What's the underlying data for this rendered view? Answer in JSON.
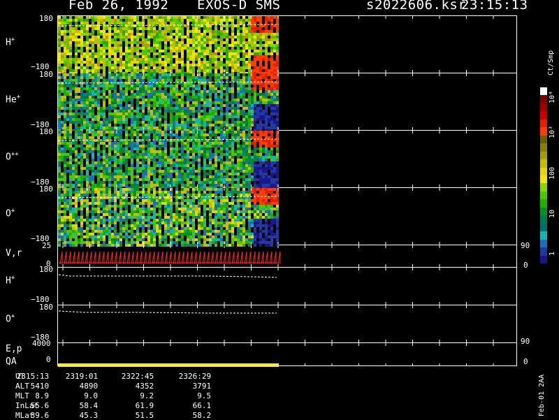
{
  "header": {
    "date": "Feb 26, 1992",
    "instrument": "EXOS-D SMS",
    "file": "s2022606.ksr",
    "time": "23:15:13"
  },
  "panels": [
    {
      "id": "h_plus",
      "label": "H",
      "sup": "+",
      "ymax": "180",
      "ymin": "−180"
    },
    {
      "id": "he_plus",
      "label": "He",
      "sup": "+",
      "ymax": "180",
      "ymin": "−180"
    },
    {
      "id": "o_pp",
      "label": "O",
      "sup": "++",
      "ymax": "180",
      "ymin": "−180"
    },
    {
      "id": "o_plus",
      "label": "O",
      "sup": "+",
      "ymax": "180",
      "ymin": "−180"
    }
  ],
  "vr_panel": {
    "label": "V,r",
    "ytop": "25",
    "ybot": "0",
    "rtop": "90",
    "rbot": "0"
  },
  "h_plus2": {
    "label": "H",
    "sup": "+",
    "ymax": "180",
    "ymin": "−180"
  },
  "o_plus2": {
    "label": "O",
    "sup": "+",
    "ymax": "180",
    "ymin": "−180"
  },
  "ep_panel": {
    "label": "E,p",
    "ytop": "4000",
    "ybot": "0",
    "rtop": "90",
    "rbot": "0"
  },
  "qa": {
    "label": "QA"
  },
  "colorbar": {
    "unit": "Ct/Smp",
    "ticks": [
      "10⁴",
      "10³",
      "100",
      "10",
      "1"
    ],
    "colors": [
      "#ffffff",
      "#7a0000",
      "#a00000",
      "#c80000",
      "#e61e00",
      "#ff3c00",
      "#6b5e00",
      "#8a7f00",
      "#a89c00",
      "#c8bc00",
      "#e6d600",
      "#f0e800",
      "#8ad400",
      "#4ec800",
      "#21b000",
      "#0a8c28",
      "#007850",
      "#006e6e",
      "#13b4b4",
      "#1e6ebe",
      "#1e3ca0",
      "#1e148c"
    ]
  },
  "ephemeris": {
    "rows": [
      {
        "name": "UT",
        "values": [
          "2315:13",
          "2319:01",
          "2322:45",
          "2326:29"
        ]
      },
      {
        "name": "ALT",
        "values": [
          "5410",
          "4890",
          "4352",
          "3791"
        ]
      },
      {
        "name": "MLT",
        "values": [
          "8.9",
          "9.0",
          "9.2",
          "9.5"
        ]
      },
      {
        "name": "InLat",
        "values": [
          "55.6",
          "58.4",
          "61.9",
          "66.1"
        ]
      },
      {
        "name": "MLat",
        "values": [
          "39.6",
          "45.3",
          "51.5",
          "58.2"
        ]
      }
    ]
  },
  "footer_side": "Feb-01 2AA",
  "chart_data": {
    "type": "heatmap",
    "title": "Feb 26, 1992   EXOS-D SMS",
    "x_ticks": [
      "2315:13",
      "2319:01",
      "2322:45",
      "2326:29"
    ],
    "ylim": [
      -180,
      180
    ],
    "series": [
      {
        "name": "H+"
      },
      {
        "name": "He+"
      },
      {
        "name": "O++"
      },
      {
        "name": "O+"
      }
    ],
    "color_scale": {
      "label": "Ct/Smp",
      "scale": "log",
      "min": 1,
      "max": 10000
    }
  }
}
